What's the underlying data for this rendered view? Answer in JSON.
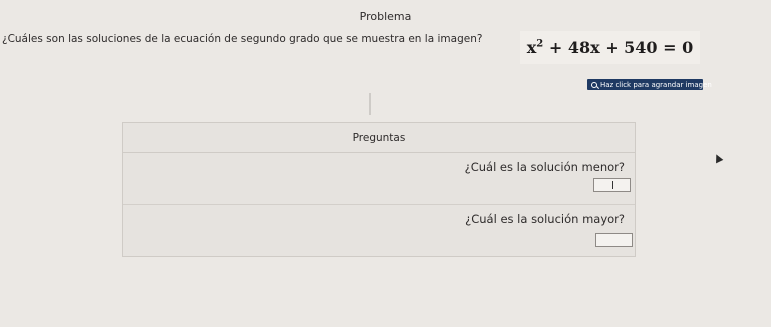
{
  "header": {
    "title": "Problema"
  },
  "problem": {
    "question": "¿Cuáles son las soluciones de la ecuación de segundo grado que se muestra en la imagen?",
    "equation": {
      "base": "x",
      "exponent": "2",
      "rest": " + 48x + 540 = 0"
    },
    "zoom_button_label": "Haz click para agrandar imagen",
    "zoom_icon": "magnifier-icon"
  },
  "panel": {
    "header": "Preguntas",
    "questions": [
      {
        "label": "¿Cuál es la solución menor?",
        "answer_value": ""
      },
      {
        "label": "¿Cuál es la solución mayor?",
        "answer_value": ""
      }
    ]
  },
  "colors": {
    "background": "#ebe8e4",
    "zoom_button": "#1f3a63",
    "text": "#2e2b2b"
  }
}
